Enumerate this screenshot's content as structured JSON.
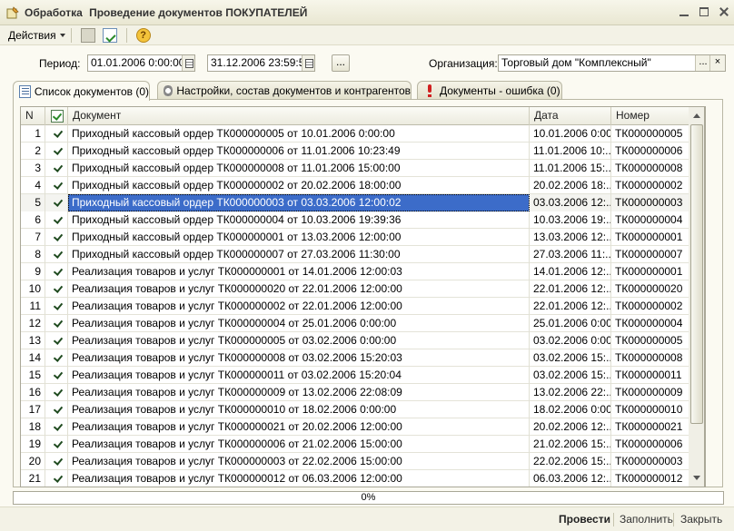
{
  "window": {
    "title_part1": "Обработка",
    "title_part2": "Проведение документов ПОКУПАТЕЛЕЙ"
  },
  "toolbar": {
    "actions_label": "Действия",
    "help_label": "?"
  },
  "filters": {
    "period_label": "Период:",
    "date_from": "01.01.2006  0:00:00",
    "date_to": "31.12.2006 23:59:59",
    "dots_label": "...",
    "org_label": "Организация:",
    "org_value": "Торговый дом \"Комплексный\"",
    "org_select": "...",
    "org_clear": "×"
  },
  "tabs": [
    {
      "label": "Список документов (0)"
    },
    {
      "label": "Настройки, состав документов и контрагентов"
    },
    {
      "label": "Документы - ошибка (0)"
    }
  ],
  "table": {
    "headers": {
      "n": "N",
      "document": "Документ",
      "date": "Дата",
      "number": "Номер"
    },
    "rows": [
      {
        "n": "1",
        "document": "Приходный кассовый ордер ТК000000005 от 10.01.2006 0:00:00",
        "date": "10.01.2006 0:00:00",
        "number": "ТК000000005"
      },
      {
        "n": "2",
        "document": "Приходный кассовый ордер ТК000000006 от 11.01.2006 10:23:49",
        "date": "11.01.2006 10:...",
        "number": "ТК000000006"
      },
      {
        "n": "3",
        "document": "Приходный кассовый ордер ТК000000008 от 11.01.2006 15:00:00",
        "date": "11.01.2006 15:...",
        "number": "ТК000000008"
      },
      {
        "n": "4",
        "document": "Приходный кассовый ордер ТК000000002 от 20.02.2006 18:00:00",
        "date": "20.02.2006 18:...",
        "number": "ТК000000002"
      },
      {
        "n": "5",
        "document": "Приходный кассовый ордер ТК000000003 от 03.03.2006 12:00:02",
        "date": "03.03.2006 12:...",
        "number": "ТК000000003"
      },
      {
        "n": "6",
        "document": "Приходный кассовый ордер ТК000000004 от 10.03.2006 19:39:36",
        "date": "10.03.2006 19:...",
        "number": "ТК000000004"
      },
      {
        "n": "7",
        "document": "Приходный кассовый ордер ТК000000001 от 13.03.2006 12:00:00",
        "date": "13.03.2006 12:...",
        "number": "ТК000000001"
      },
      {
        "n": "8",
        "document": "Приходный кассовый ордер ТК000000007 от 27.03.2006 11:30:00",
        "date": "27.03.2006 11:...",
        "number": "ТК000000007"
      },
      {
        "n": "9",
        "document": "Реализация товаров и услуг ТК000000001 от 14.01.2006 12:00:03",
        "date": "14.01.2006 12:...",
        "number": "ТК000000001"
      },
      {
        "n": "10",
        "document": "Реализация товаров и услуг ТК000000020 от 22.01.2006 12:00:00",
        "date": "22.01.2006 12:...",
        "number": "ТК000000020"
      },
      {
        "n": "11",
        "document": "Реализация товаров и услуг ТК000000002 от 22.01.2006 12:00:00",
        "date": "22.01.2006 12:...",
        "number": "ТК000000002"
      },
      {
        "n": "12",
        "document": "Реализация товаров и услуг ТК000000004 от 25.01.2006 0:00:00",
        "date": "25.01.2006 0:00:00",
        "number": "ТК000000004"
      },
      {
        "n": "13",
        "document": "Реализация товаров и услуг ТК000000005 от 03.02.2006 0:00:00",
        "date": "03.02.2006 0:00:00",
        "number": "ТК000000005"
      },
      {
        "n": "14",
        "document": "Реализация товаров и услуг ТК000000008 от 03.02.2006 15:20:03",
        "date": "03.02.2006 15:...",
        "number": "ТК000000008"
      },
      {
        "n": "15",
        "document": "Реализация товаров и услуг ТК000000011 от 03.02.2006 15:20:04",
        "date": "03.02.2006 15:...",
        "number": "ТК000000011"
      },
      {
        "n": "16",
        "document": "Реализация товаров и услуг ТК000000009 от 13.02.2006 22:08:09",
        "date": "13.02.2006 22:...",
        "number": "ТК000000009"
      },
      {
        "n": "17",
        "document": "Реализация товаров и услуг ТК000000010 от 18.02.2006 0:00:00",
        "date": "18.02.2006 0:00:00",
        "number": "ТК000000010"
      },
      {
        "n": "18",
        "document": "Реализация товаров и услуг ТК000000021 от 20.02.2006 12:00:00",
        "date": "20.02.2006 12:...",
        "number": "ТК000000021"
      },
      {
        "n": "19",
        "document": "Реализация товаров и услуг ТК000000006 от 21.02.2006 15:00:00",
        "date": "21.02.2006 15:...",
        "number": "ТК000000006"
      },
      {
        "n": "20",
        "document": "Реализация товаров и услуг ТК000000003 от 22.02.2006 15:00:00",
        "date": "22.02.2006 15:...",
        "number": "ТК000000003"
      },
      {
        "n": "21",
        "document": "Реализация товаров и услуг ТК000000012 от 06.03.2006 12:00:00",
        "date": "06.03.2006 12:...",
        "number": "ТК000000012"
      }
    ],
    "selected_row": 4
  },
  "progress": {
    "text": "0%",
    "value": 0
  },
  "footer": {
    "post_label": "Провести",
    "fill_label": "Заполнить",
    "close_label": "Закрыть"
  },
  "colors": {
    "selection": "#3c6cc9",
    "window_bg": "#fbfaf2"
  },
  "icons": [
    "app-icon",
    "minimize-icon",
    "maximize-icon",
    "close-icon",
    "document-icon",
    "post-document-icon",
    "help-icon",
    "calendar-icon",
    "list-icon",
    "gear-icon",
    "error-icon",
    "checkmark-icon"
  ]
}
